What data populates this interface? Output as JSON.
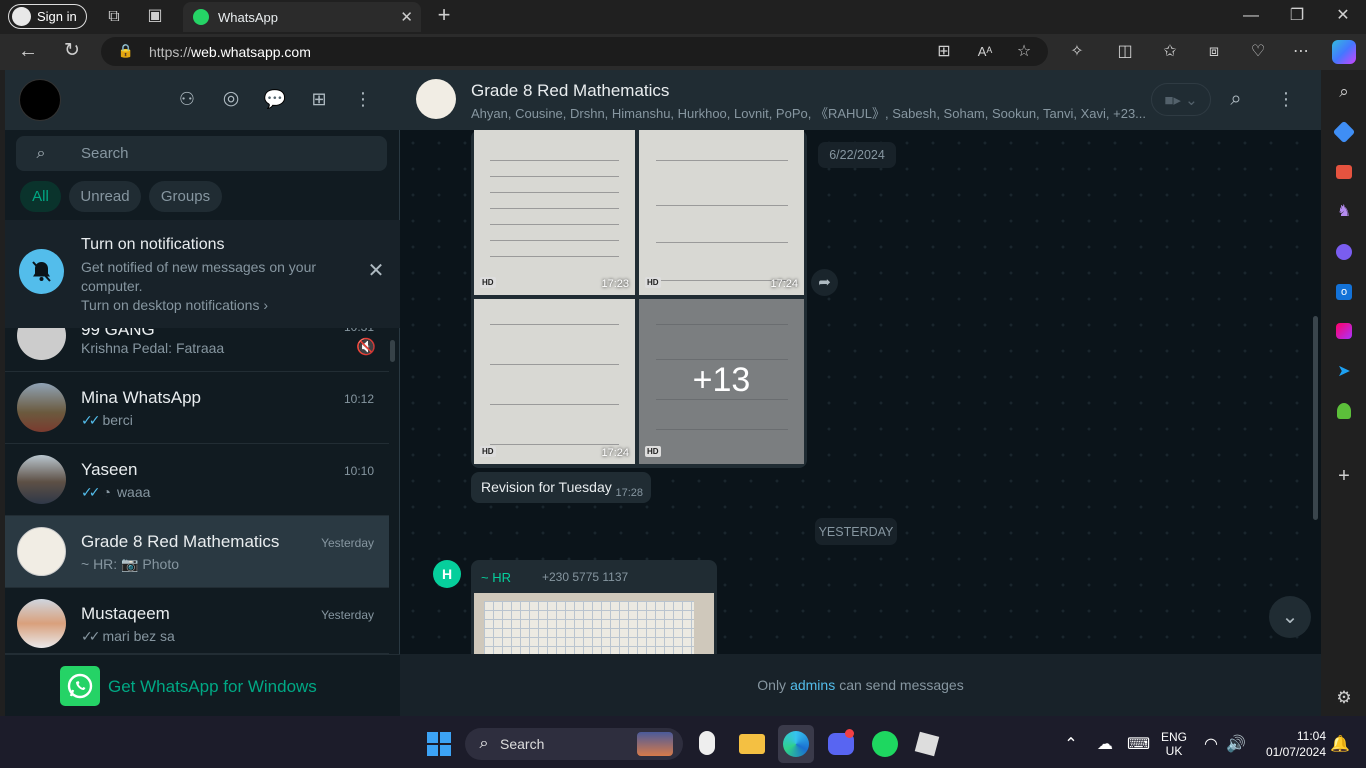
{
  "browser": {
    "sign_in": "Sign in",
    "tab_title": "WhatsApp",
    "url_scheme": "https://",
    "url_host": "web.whatsapp.com"
  },
  "sidebar": {
    "search_placeholder": "Search",
    "filters": [
      "All",
      "Unread",
      "Groups"
    ],
    "notification": {
      "title": "Turn on notifications",
      "body_line1": "Get notified of new messages on your",
      "body_line2": "computer.",
      "link": "Turn on desktop notifications"
    },
    "chats": [
      {
        "name": "99 GANG",
        "preview": "Krishna Pedal: Fatraaa",
        "time": "10:31"
      },
      {
        "name": "Mina WhatsApp",
        "preview": "berci",
        "time": "10:12"
      },
      {
        "name": "Yaseen",
        "preview": "waaa",
        "time": "10:10"
      },
      {
        "name": "Grade 8 Red  Mathematics",
        "preview_prefix": "~ HR:",
        "preview": "Photo",
        "time": "Yesterday"
      },
      {
        "name": "Mustaqeem",
        "preview": "mari bez sa",
        "time": "Yesterday"
      }
    ],
    "promo": "Get WhatsApp for Windows"
  },
  "conversation": {
    "title": "Grade 8 Red  Mathematics",
    "members": "Ahyan, Cousine, Drshn, Himanshu, Hurkhoo, Lovnit, PoPo, 《RAHUL》, Sabesh, Soham, Sookun, Tanvi, Xavi, +23...",
    "date_pill": "6/22/2024",
    "photo_times": [
      "17:23",
      "17:24",
      "17:24"
    ],
    "photo_badge": "HD",
    "more_count": "+13",
    "caption": "Revision for Tuesday",
    "caption_time": "17:28",
    "yesterday_pill": "YESTERDAY",
    "sender_initial": "H",
    "sender_name": "~ HR",
    "sender_phone": "+230 5775 1137",
    "footer_before": "Only",
    "footer_link": "admins",
    "footer_after": "can send messages"
  },
  "taskbar": {
    "search": "Search",
    "lang1": "ENG",
    "lang2": "UK",
    "time": "11:04",
    "date": "01/07/2024"
  },
  "colors": {
    "accent": "#00a884",
    "panel": "#202c33",
    "background": "#111b21",
    "link": "#53bdeb"
  }
}
